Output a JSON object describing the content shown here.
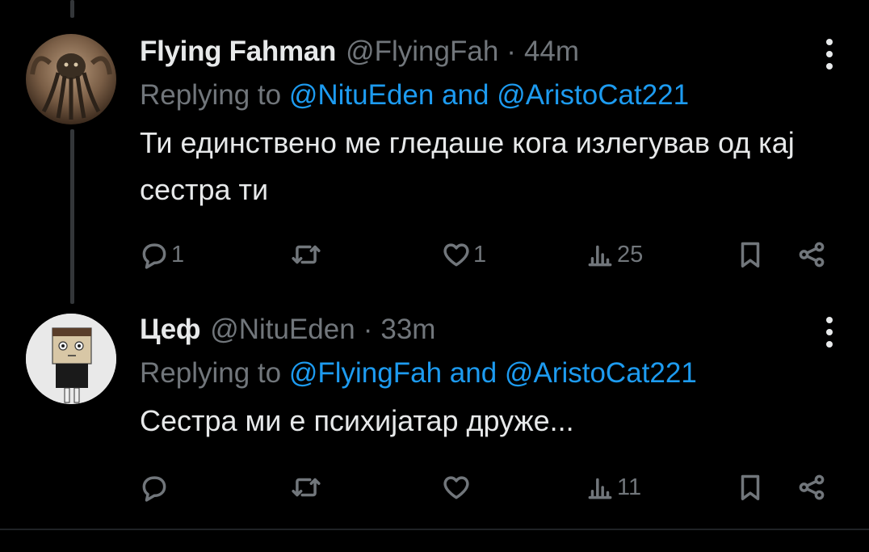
{
  "tweets": [
    {
      "display_name": "Flying Fahman",
      "handle": "@FlyingFah",
      "separator": "·",
      "time": "44m",
      "reply_prefix": "Replying to",
      "mention1": "@NituEden",
      "conjunction": "and",
      "mention2": "@AristoCat221",
      "text": "Ти единствено ме гледаше кога излегував од кај сестра ти",
      "replies": "1",
      "reposts": "",
      "likes": "1",
      "views": "25",
      "avatar_icon": "cthulhu-avatar"
    },
    {
      "display_name": "Цеф",
      "handle": "@NituEden",
      "separator": "·",
      "time": "33m",
      "reply_prefix": "Replying to",
      "mention1": "@FlyingFah",
      "conjunction": "and",
      "mention2": "@AristoCat221",
      "text": "Сестра ми е психијатар друже...",
      "replies": "",
      "reposts": "",
      "likes": "",
      "views": "11",
      "avatar_icon": "cartoon-character-avatar"
    }
  ],
  "colors": {
    "background": "#000000",
    "text": "#e7e9ea",
    "muted": "#71767b",
    "accent": "#1d9bf0",
    "thread_line": "#333639"
  },
  "icons": [
    "reply-icon",
    "repost-icon",
    "like-icon",
    "views-icon",
    "bookmark-icon",
    "share-icon",
    "more-icon"
  ]
}
